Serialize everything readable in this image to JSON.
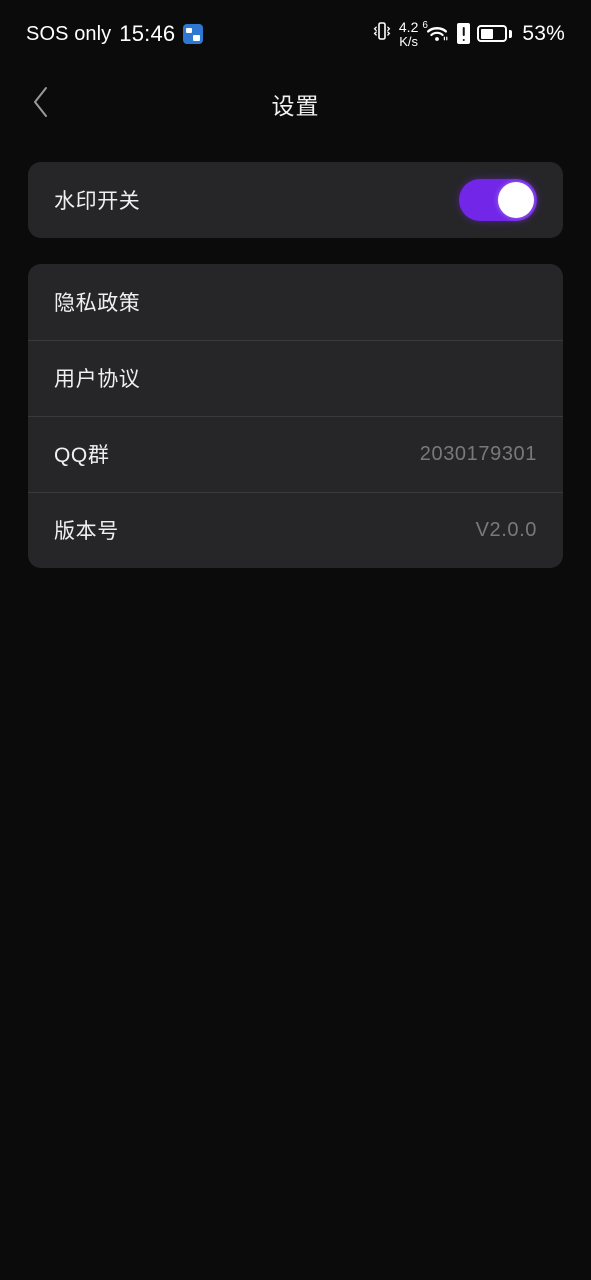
{
  "status_bar": {
    "carrier": "SOS only",
    "time": "15:46",
    "app_badge_icon": "app-badge-icon",
    "vibrate_icon": "vibrate-icon",
    "net_speed_value": "4.2",
    "net_speed_unit": "K/s",
    "wifi_generation": "6",
    "wifi_icon": "wifi-icon",
    "sim_alert_icon": "sim-alert-icon",
    "battery_icon": "battery-icon",
    "battery_percent": "53%",
    "battery_level": 53
  },
  "header": {
    "back_icon": "chevron-left-icon",
    "title": "设置"
  },
  "settings_card": {
    "watermark": {
      "label": "水印开关",
      "toggle_state": "on",
      "toggle_on_color": "#7226e8",
      "toggle_knob_color": "#ffffff"
    }
  },
  "info_card": {
    "rows": [
      {
        "label": "隐私政策",
        "value": ""
      },
      {
        "label": "用户协议",
        "value": ""
      },
      {
        "label": "QQ群",
        "value": "2030179301"
      },
      {
        "label": "版本号",
        "value": "V2.0.0"
      }
    ]
  },
  "theme": {
    "page_background": "#0b0b0c",
    "card_background": "#262628",
    "divider": "#3a3a3c",
    "primary_text": "#f0f0f0",
    "secondary_text": "#79797c",
    "accent": "#7226e8"
  }
}
